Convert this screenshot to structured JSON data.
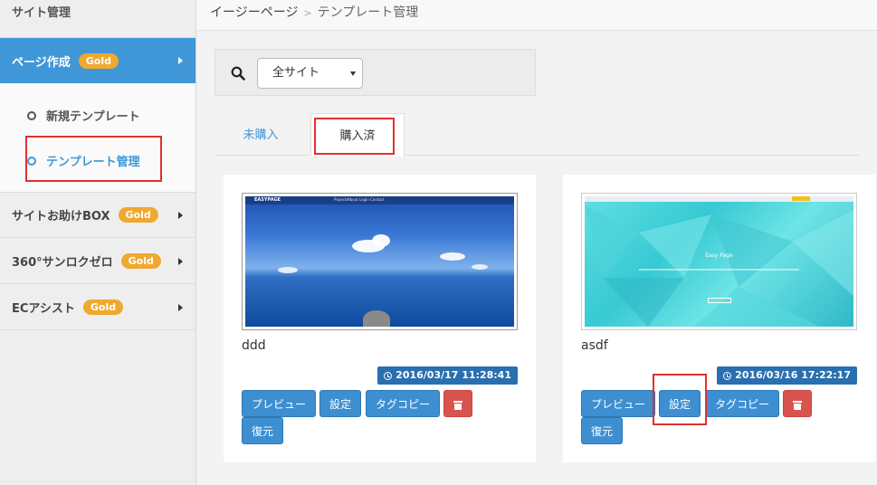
{
  "sidebar": {
    "title": "サイト管理",
    "items": [
      {
        "label": "ページ作成",
        "badge": "Gold"
      },
      {
        "label": "サイトお助けBOX",
        "badge": "Gold"
      },
      {
        "label": "360°サンロクゼロ",
        "badge": "Gold"
      },
      {
        "label": "ECアシスト",
        "badge": "Gold"
      }
    ],
    "subitems": [
      {
        "label": "新規テンプレート"
      },
      {
        "label": "テンプレート管理"
      }
    ]
  },
  "breadcrumb": {
    "root": "イージーページ",
    "current": "テンプレート管理"
  },
  "filter": {
    "site_select": "全サイト",
    "search_icon": "search-icon"
  },
  "tabs": [
    {
      "label": "未購入"
    },
    {
      "label": "購入済"
    }
  ],
  "templates": [
    {
      "name": "ddd",
      "date": "2016/03/17 11:28:41",
      "thumb_brand": "EASYPAGE",
      "thumb_nav": [
        "Projects",
        "About",
        "Login",
        "Contact"
      ],
      "buttons": {
        "preview": "プレビュー",
        "settings": "設定",
        "tagcopy": "タグコピー",
        "restore": "復元"
      }
    },
    {
      "name": "asdf",
      "date": "2016/03/16 17:22:17",
      "thumb_title": "Easy Page",
      "buttons": {
        "preview": "プレビュー",
        "settings": "設定",
        "tagcopy": "タグコピー",
        "restore": "復元"
      }
    }
  ],
  "colors": {
    "accent": "#3f97d8",
    "gold": "#f0a830",
    "danger": "#d9534f",
    "date_badge": "#2a6fb0",
    "highlight": "#e03030"
  }
}
